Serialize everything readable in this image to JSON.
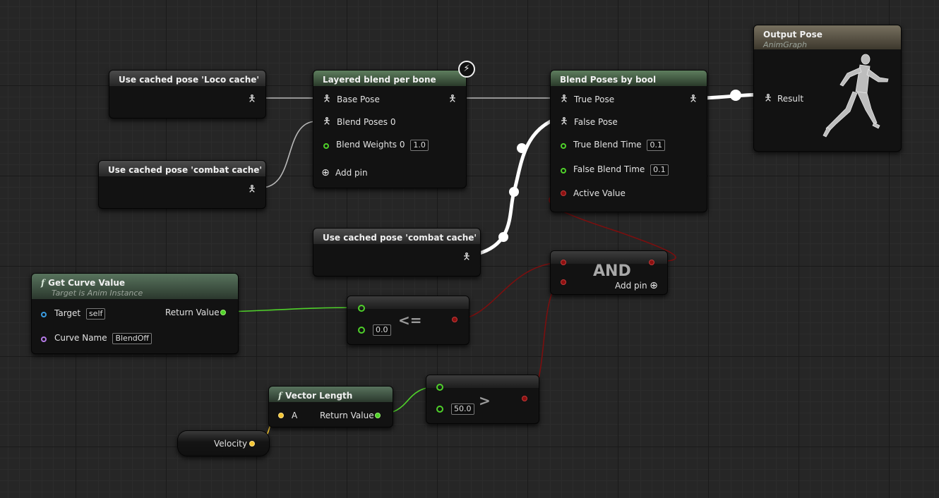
{
  "nodes": {
    "cache_loco": {
      "title": "Use cached pose 'Loco cache'"
    },
    "cache_combat_1": {
      "title": "Use cached pose 'combat cache'"
    },
    "cache_combat_2": {
      "title": "Use cached pose 'combat cache'"
    },
    "layered_blend": {
      "title": "Layered blend per bone",
      "base_pose": "Base Pose",
      "blend_poses": "Blend Poses 0",
      "blend_weights": "Blend Weights 0",
      "blend_weights_value": "1.0",
      "add_pin": "Add pin"
    },
    "blend_bool": {
      "title": "Blend Poses by bool",
      "true_pose": "True Pose",
      "false_pose": "False Pose",
      "true_blend_time": "True Blend Time",
      "true_blend_time_value": "0.1",
      "false_blend_time": "False Blend Time",
      "false_blend_time_value": "0.1",
      "active_value": "Active Value"
    },
    "output_pose": {
      "title": "Output Pose",
      "subtitle": "AnimGraph",
      "result": "Result"
    },
    "get_curve": {
      "title": "Get Curve Value",
      "subtitle": "Target is Anim Instance",
      "target": "Target",
      "target_value": "self",
      "curve_name": "Curve Name",
      "curve_name_value": "BlendOff",
      "return_value": "Return Value"
    },
    "lte": {
      "symbol": "<=",
      "value": "0.0"
    },
    "and": {
      "symbol": "AND",
      "add_pin": "Add pin"
    },
    "vector_length": {
      "title": "Vector Length",
      "input": "A",
      "return_value": "Return Value"
    },
    "gt": {
      "symbol": ">",
      "value": "50.0"
    },
    "velocity": {
      "label": "Velocity"
    }
  },
  "icons": {
    "function": "f",
    "pose_pin": "person-icon",
    "fast_path": "lightning-bolt-icon",
    "add": "plus-circle-icon"
  },
  "colors": {
    "pose_header": "#4c4c4c",
    "blend_header": "#5e7e5e",
    "output_header": "#77705f",
    "float_pin": "#4fd12a",
    "bool_pin": "#8c1010",
    "vector_pin": "#f4c531",
    "object_pin": "#3a9be0",
    "name_pin": "#b47ae6"
  }
}
